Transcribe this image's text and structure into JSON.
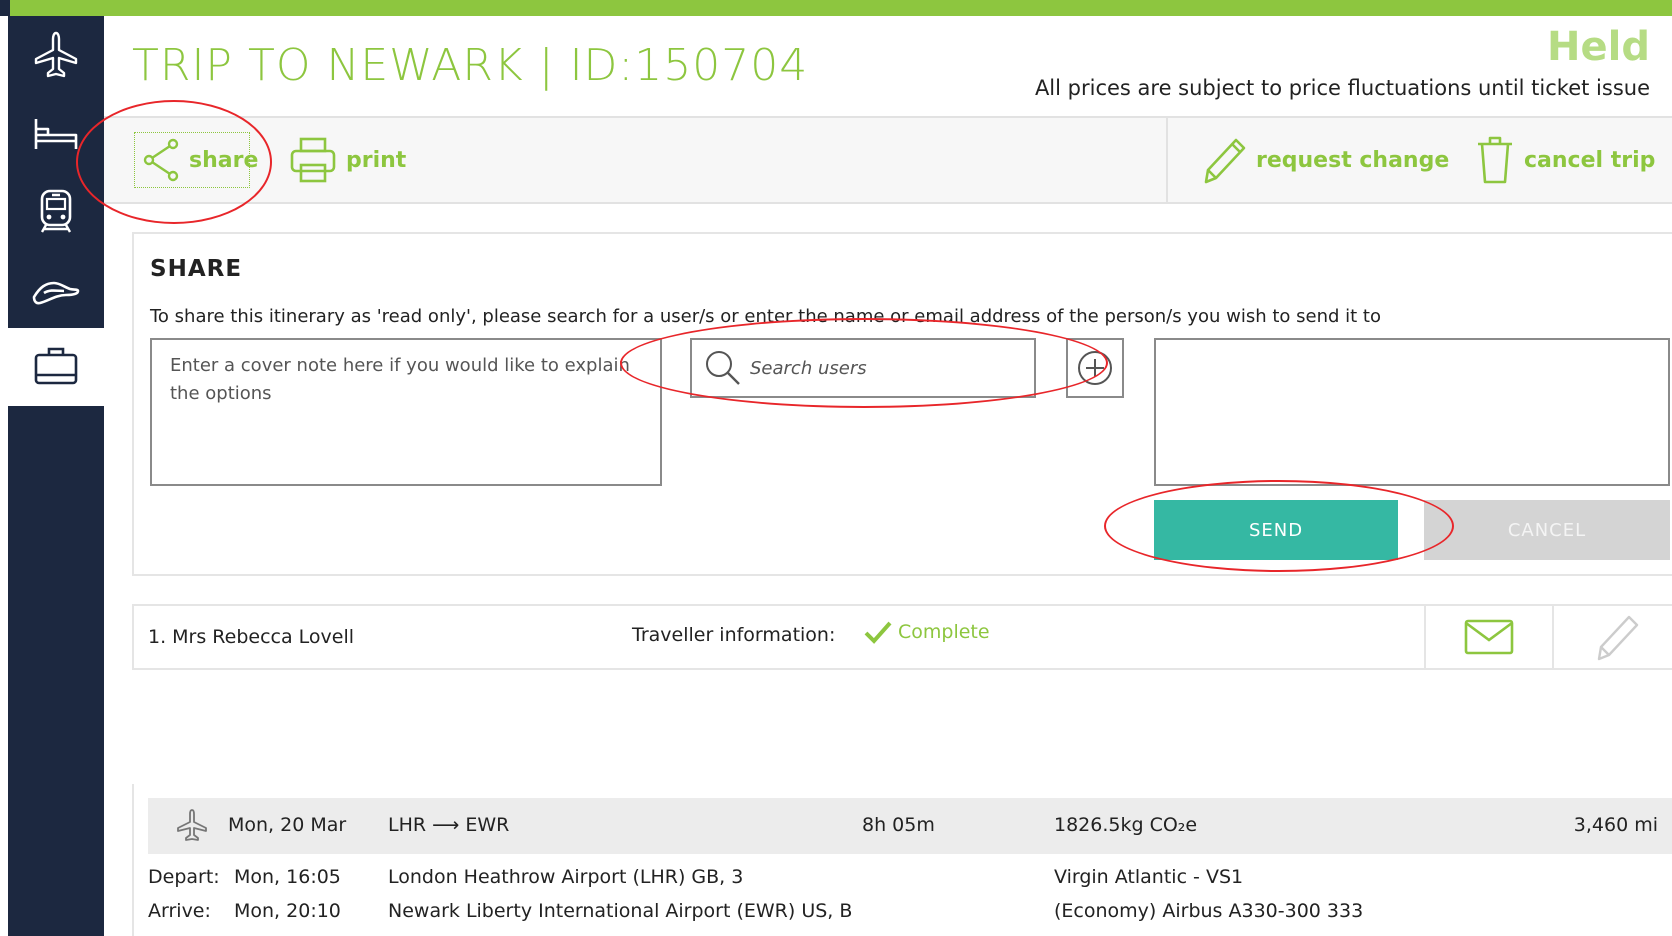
{
  "header": {
    "title": "TRIP TO NEWARK | ID:150704",
    "status": "Held",
    "price_note": "All prices are subject to price fluctuations until ticket issue"
  },
  "nav": {
    "items": [
      {
        "icon": "plane-icon"
      },
      {
        "icon": "bed-icon"
      },
      {
        "icon": "train-icon"
      },
      {
        "icon": "car-icon"
      },
      {
        "icon": "briefcase-icon"
      }
    ]
  },
  "toolbar": {
    "share_label": "share",
    "print_label": "print",
    "request_change_label": "request change",
    "cancel_trip_label": "cancel trip"
  },
  "share": {
    "heading": "SHARE",
    "instruction": "To share this itinerary as 'read only', please search for a user/s or enter the name or email address of the person/s you wish to send it to",
    "cover_note_placeholder": "Enter a cover note here if you would like to explain the options",
    "search_placeholder": "Search users",
    "send_label": "SEND",
    "cancel_label": "CANCEL"
  },
  "traveller": {
    "name": "1. Mrs Rebecca Lovell",
    "info_label": "Traveller information:",
    "info_status": "Complete"
  },
  "flight": {
    "date": "Mon, 20 Mar",
    "route": "LHR ⟶ EWR",
    "duration": "8h 05m",
    "co2": "1826.5kg CO₂e",
    "distance": "3,460 mi",
    "depart_label": "Depart:",
    "depart_time": "Mon, 16:05",
    "depart_airport": "London Heathrow Airport (LHR) GB, 3",
    "carrier": "Virgin Atlantic - VS1",
    "arrive_label": "Arrive:",
    "arrive_time": "Mon, 20:10",
    "arrive_airport": "Newark Liberty International Airport (EWR) US, B",
    "cabin": "(Economy) Airbus A330-300 333"
  },
  "colors": {
    "accent_green": "#8dc63f",
    "nav_bg": "#1c2840",
    "send_teal": "#35b8a3",
    "annotation_red": "#e8262a"
  }
}
